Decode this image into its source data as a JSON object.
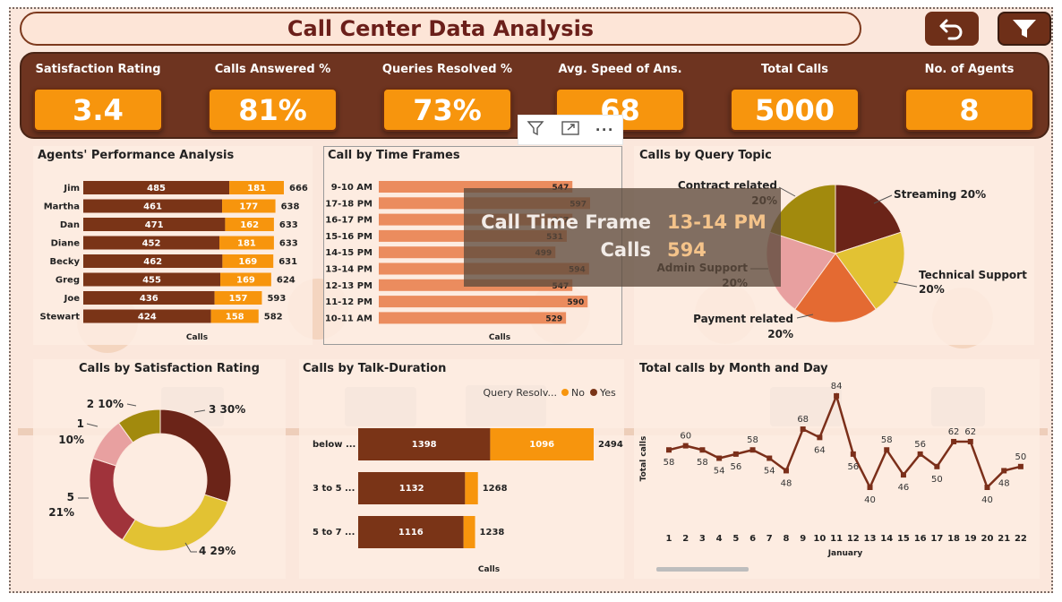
{
  "header": {
    "title": "Call Center Data Analysis"
  },
  "buttons": {
    "back_icon": "undo-arrow-icon",
    "filter_icon": "funnel-icon"
  },
  "colors": {
    "brown": "#6e2f18",
    "orange": "#f7950d",
    "dark_brown_bar": "#7a3417",
    "salmon_bar": "#eb8c5e",
    "line": "#7b2f1a"
  },
  "kpis": [
    {
      "label": "Satisfaction Rating",
      "value": "3.4"
    },
    {
      "label": "Calls Answered %",
      "value": "81%"
    },
    {
      "label": "Queries Resolved %",
      "value": "73%"
    },
    {
      "label": "Avg. Speed of Ans.",
      "value": "68"
    },
    {
      "label": "Total Calls",
      "value": "5000"
    },
    {
      "label": "No. of Agents",
      "value": "8"
    }
  ],
  "visual_toolbar": {
    "filter_icon": "filter-icon",
    "focus_icon": "focus-mode-icon",
    "more_icon": "more-options-icon",
    "more_label": "···"
  },
  "tooltip": {
    "label1": "Call Time Frame",
    "value1": "13-14 PM",
    "label2": "Calls",
    "value2": "594"
  },
  "agents": {
    "title": "Agents' Performance Analysis",
    "xlabel": "Calls"
  },
  "timeframes": {
    "title": "Call by Time Frames",
    "xlabel": "Calls"
  },
  "topics": {
    "title": "Calls by Query Topic"
  },
  "satisfaction": {
    "title": "Calls by Satisfaction Rating"
  },
  "talk": {
    "title": "Calls by Talk-Duration",
    "legend_title": "Query Resolv...",
    "legend_no": "No",
    "legend_yes": "Yes",
    "xlabel": "Calls"
  },
  "monthly": {
    "title": "Total calls by Month and Day",
    "ylabel": "Total calls",
    "xlabel": "January"
  },
  "chart_data": [
    {
      "type": "bar",
      "orientation": "horizontal-stacked",
      "title": "Agents' Performance Analysis",
      "xlabel": "Calls",
      "categories": [
        "Jim",
        "Martha",
        "Dan",
        "Diane",
        "Becky",
        "Greg",
        "Joe",
        "Stewart"
      ],
      "series": [
        {
          "values": [
            485,
            461,
            471,
            452,
            462,
            455,
            436,
            424
          ]
        },
        {
          "values": [
            181,
            177,
            162,
            181,
            169,
            169,
            157,
            158
          ]
        }
      ],
      "totals": [
        666,
        638,
        633,
        633,
        631,
        624,
        593,
        582
      ]
    },
    {
      "type": "bar",
      "orientation": "horizontal",
      "title": "Call by Time Frames",
      "xlabel": "Calls",
      "categories": [
        "9-10 AM",
        "17-18 PM",
        "16-17 PM",
        "15-16 PM",
        "14-15 PM",
        "13-14 PM",
        "12-13 PM",
        "11-12 PM",
        "10-11 AM"
      ],
      "values": [
        547,
        597,
        547,
        531,
        499,
        594,
        547,
        590,
        529
      ]
    },
    {
      "type": "pie",
      "title": "Calls by Query Topic",
      "labels": [
        "Streaming",
        "Technical Support",
        "Payment related",
        "Admin Support",
        "Contract related"
      ],
      "values": [
        20,
        20,
        20,
        20,
        20
      ],
      "display_labels": [
        "Streaming 20%",
        "Technical Support",
        "Payment related",
        "Admin Support",
        "Contract related"
      ],
      "display_pct": [
        "",
        "20%",
        "20%",
        "20%",
        "20%"
      ],
      "colors": [
        "#6b2418",
        "#e2c233",
        "#e46a32",
        "#e8a0a0",
        "#a28a0d"
      ]
    },
    {
      "type": "pie",
      "subtype": "donut",
      "title": "Calls by Satisfaction Rating",
      "labels": [
        "3",
        "4",
        "5",
        "1",
        "2"
      ],
      "values": [
        30,
        29,
        21,
        10,
        10
      ],
      "display_labels": [
        "3 30%",
        "4 29%",
        "5",
        "1",
        "2 10%"
      ],
      "display_pct": [
        "",
        "",
        "21%",
        "10%",
        ""
      ],
      "colors": [
        "#6b2418",
        "#e2c233",
        "#a0333b",
        "#e8a0a0",
        "#a28a0d"
      ]
    },
    {
      "type": "bar",
      "orientation": "horizontal-stacked",
      "title": "Calls by Talk-Duration",
      "xlabel": "Calls",
      "legend_title": "Query Resolv...",
      "categories": [
        "below ...",
        "3 to 5 ...",
        "5 to 7 ..."
      ],
      "series": [
        {
          "name": "Yes",
          "values": [
            1398,
            1132,
            1116
          ]
        },
        {
          "name": "No",
          "values": [
            1096,
            136,
            122
          ]
        }
      ],
      "totals": [
        2494,
        1268,
        1238
      ]
    },
    {
      "type": "line",
      "title": "Total calls by Month and Day",
      "xlabel": "January",
      "ylabel": "Total calls",
      "x": [
        1,
        2,
        3,
        4,
        5,
        6,
        7,
        8,
        9,
        10,
        11,
        12,
        13,
        14,
        15,
        16,
        17,
        18,
        19,
        20,
        21,
        22
      ],
      "y": [
        58,
        60,
        58,
        54,
        56,
        58,
        54,
        48,
        68,
        64,
        84,
        56,
        40,
        58,
        46,
        56,
        50,
        62,
        62,
        40,
        48,
        50
      ]
    }
  ]
}
